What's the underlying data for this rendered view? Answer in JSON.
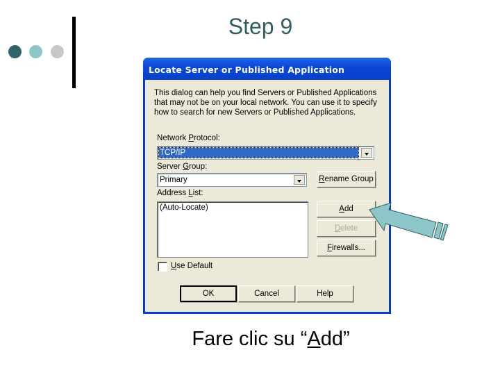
{
  "slide": {
    "title": "Step 9",
    "caption_prefix": "Fare clic su “",
    "caption_underlined": "A",
    "caption_rest": "dd”",
    "bullet_colors": [
      "#2f6569",
      "#8dc6c9",
      "#c8c8c8"
    ],
    "arrow_color": "#8dc6c9"
  },
  "dialog": {
    "title": "Locate Server or Published Application",
    "description": "This dialog can help you find Servers or Published Applications that may not be on your local network.  You can use it to specify how to search for new Servers or Published Applications.",
    "network_protocol": {
      "label_pre": "Network ",
      "label_accel": "P",
      "label_post": "rotocol:",
      "value": "TCP/IP"
    },
    "server_group": {
      "label_pre": "Server ",
      "label_accel": "G",
      "label_post": "roup:",
      "value": "Primary"
    },
    "rename_group": {
      "accel": "R",
      "rest": "ename Group"
    },
    "address_list": {
      "label_pre": "Address ",
      "label_accel": "L",
      "label_post": "ist:",
      "items": [
        "(Auto-Locate)"
      ]
    },
    "add_button": {
      "accel": "A",
      "rest": "dd"
    },
    "delete_button": {
      "accel": "D",
      "rest": "elete",
      "disabled": true
    },
    "firewalls_button": {
      "accel": "F",
      "rest": "irewalls..."
    },
    "use_default": {
      "accel": "U",
      "rest": "se Default",
      "checked": false
    },
    "ok_label": "OK",
    "cancel_label": "Cancel",
    "help_label": "Help"
  }
}
